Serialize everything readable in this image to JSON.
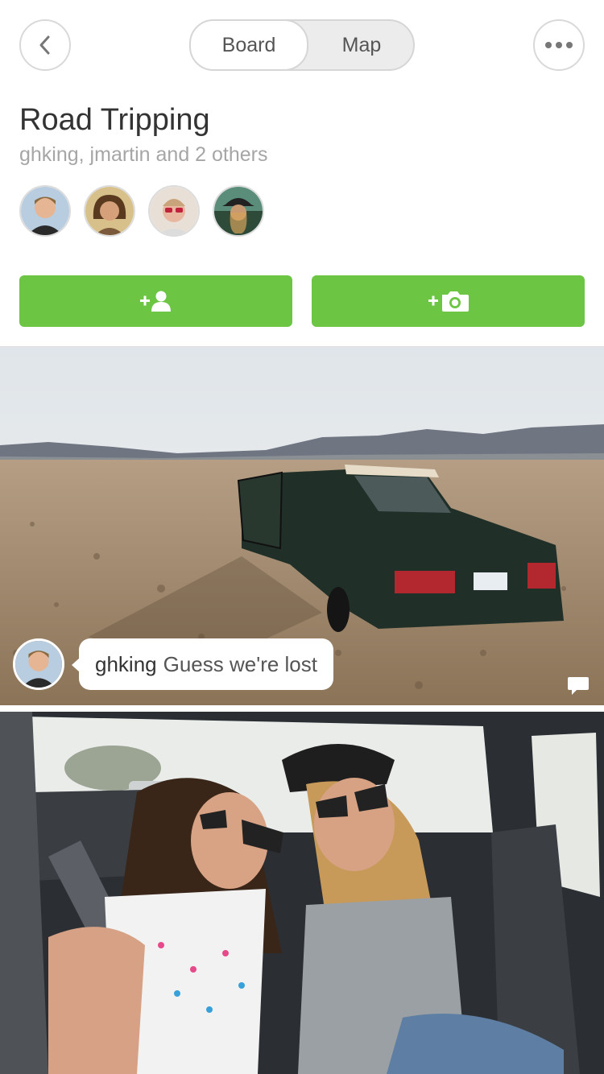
{
  "nav": {
    "segments": [
      {
        "label": "Board",
        "selected": true
      },
      {
        "label": "Map",
        "selected": false
      }
    ],
    "back_icon": "chevron-left-icon",
    "more_icon": "ellipsis-icon"
  },
  "board": {
    "title": "Road Tripping",
    "members_summary": "ghking, jmartin and 2 others",
    "members": [
      "ghking",
      "jmartin",
      "member-3",
      "member-4"
    ]
  },
  "actions": {
    "add_member_icon": "add-person-icon",
    "add_photo_icon": "add-camera-icon",
    "accent_color": "#6cc644"
  },
  "posts": [
    {
      "photo": "desert-car-photo",
      "comment": {
        "user": "ghking",
        "text": "Guess we're lost"
      }
    },
    {
      "photo": "backseat-selfie-photo"
    }
  ]
}
